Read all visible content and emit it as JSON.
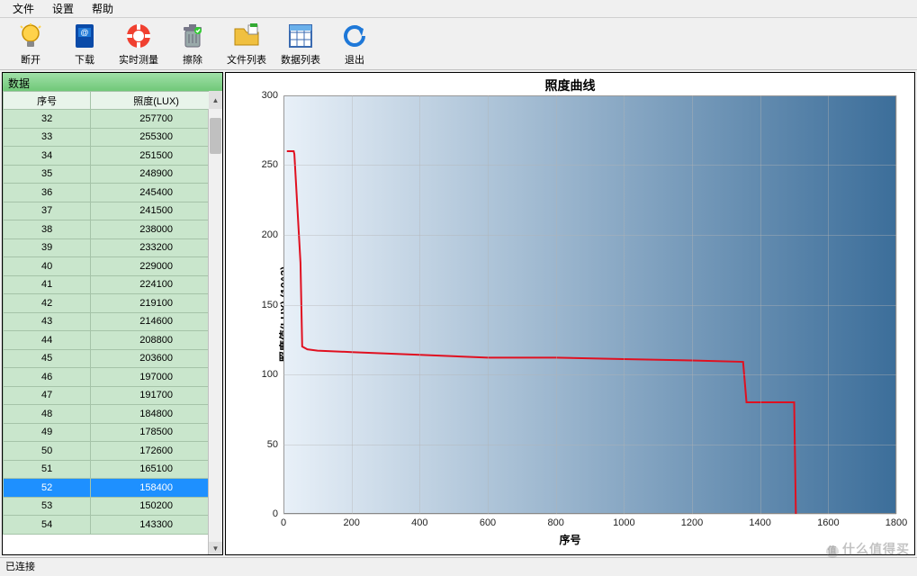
{
  "menu": {
    "items": [
      "文件",
      "设置",
      "帮助"
    ]
  },
  "toolbar": {
    "items": [
      {
        "name": "disconnect",
        "label": "断开",
        "icon": "bulb"
      },
      {
        "name": "download",
        "label": "下载",
        "icon": "book"
      },
      {
        "name": "realtime",
        "label": "实时测量",
        "icon": "lifebuoy"
      },
      {
        "name": "erase",
        "label": "擦除",
        "icon": "trash"
      },
      {
        "name": "filelist",
        "label": "文件列表",
        "icon": "folder"
      },
      {
        "name": "datalist",
        "label": "数据列表",
        "icon": "grid"
      },
      {
        "name": "exit",
        "label": "退出",
        "icon": "back"
      }
    ]
  },
  "sidebar": {
    "title": "数据",
    "columns": [
      "序号",
      "照度(LUX)"
    ],
    "selected_index": 20,
    "rows": [
      {
        "id": 32,
        "lux": 257700
      },
      {
        "id": 33,
        "lux": 255300
      },
      {
        "id": 34,
        "lux": 251500
      },
      {
        "id": 35,
        "lux": 248900
      },
      {
        "id": 36,
        "lux": 245400
      },
      {
        "id": 37,
        "lux": 241500
      },
      {
        "id": 38,
        "lux": 238000
      },
      {
        "id": 39,
        "lux": 233200
      },
      {
        "id": 40,
        "lux": 229000
      },
      {
        "id": 41,
        "lux": 224100
      },
      {
        "id": 42,
        "lux": 219100
      },
      {
        "id": 43,
        "lux": 214600
      },
      {
        "id": 44,
        "lux": 208800
      },
      {
        "id": 45,
        "lux": 203600
      },
      {
        "id": 46,
        "lux": 197000
      },
      {
        "id": 47,
        "lux": 191700
      },
      {
        "id": 48,
        "lux": 184800
      },
      {
        "id": 49,
        "lux": 178500
      },
      {
        "id": 50,
        "lux": 172600
      },
      {
        "id": 51,
        "lux": 165100
      },
      {
        "id": 52,
        "lux": 158400
      },
      {
        "id": 53,
        "lux": 150200
      },
      {
        "id": 54,
        "lux": 143300
      }
    ]
  },
  "status": {
    "text": "已连接"
  },
  "watermark": {
    "text": "什么值得买",
    "badge": "值"
  },
  "chart_data": {
    "type": "line",
    "title": "照度曲线",
    "xlabel": "序号",
    "ylabel": "照度值(LUX)  (10^3)",
    "xlim": [
      0,
      1800
    ],
    "ylim": [
      0,
      300
    ],
    "xticks": [
      0,
      200,
      400,
      600,
      800,
      1000,
      1200,
      1400,
      1600,
      1800
    ],
    "yticks": [
      0,
      50,
      100,
      150,
      200,
      250,
      300
    ],
    "series": [
      {
        "name": "lux",
        "color": "#e01020",
        "points": [
          [
            10,
            260
          ],
          [
            30,
            260
          ],
          [
            32,
            258
          ],
          [
            50,
            180
          ],
          [
            55,
            120
          ],
          [
            70,
            118
          ],
          [
            100,
            117
          ],
          [
            200,
            116
          ],
          [
            400,
            114
          ],
          [
            600,
            112
          ],
          [
            800,
            112
          ],
          [
            1000,
            111
          ],
          [
            1200,
            110
          ],
          [
            1350,
            109
          ],
          [
            1360,
            80
          ],
          [
            1500,
            80
          ],
          [
            1505,
            0
          ]
        ]
      }
    ]
  }
}
